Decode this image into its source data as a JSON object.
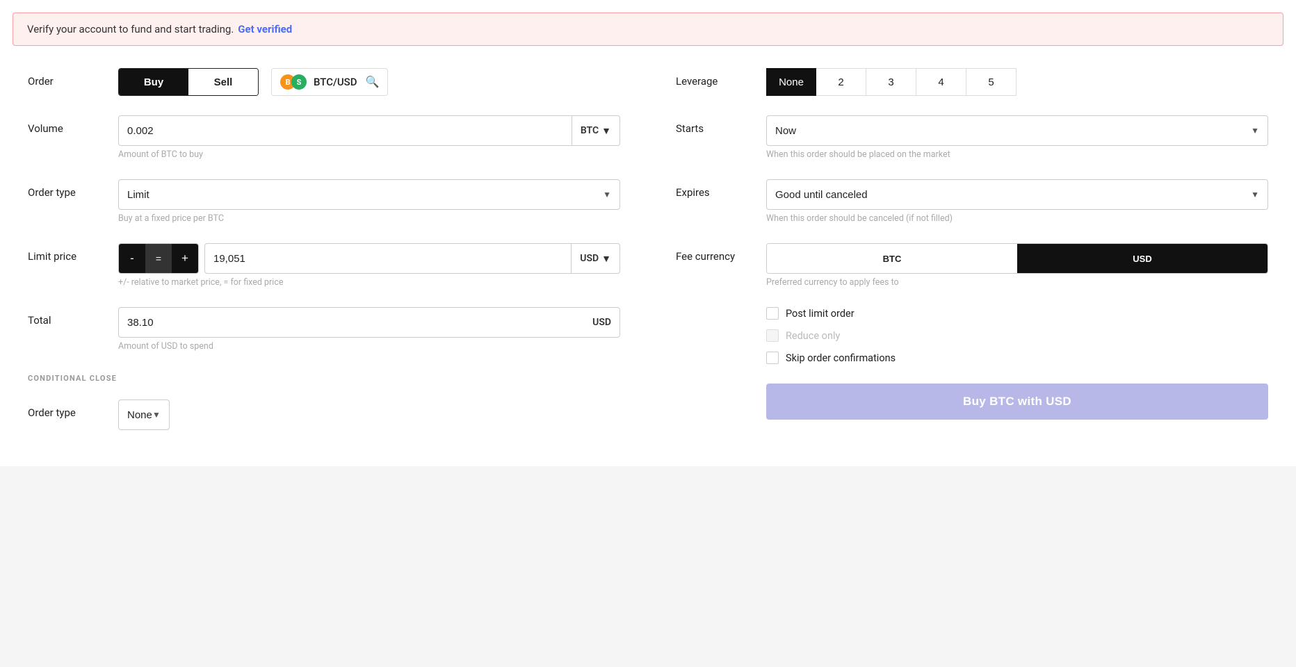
{
  "banner": {
    "text": "Verify your account to fund and start trading.",
    "link_text": "Get verified"
  },
  "order": {
    "label": "Order",
    "buy_label": "Buy",
    "sell_label": "Sell",
    "active": "Buy",
    "pair": "BTC/USD"
  },
  "leverage": {
    "label": "Leverage",
    "options": [
      "None",
      "2",
      "3",
      "4",
      "5"
    ],
    "active": "None"
  },
  "volume": {
    "label": "Volume",
    "value": "0.002",
    "currency": "BTC",
    "hint": "Amount of BTC to buy"
  },
  "starts": {
    "label": "Starts",
    "value": "Now",
    "hint": "When this order should be placed on the market"
  },
  "order_type": {
    "label": "Order type",
    "value": "Limit",
    "hint": "Buy at a fixed price per BTC"
  },
  "expires": {
    "label": "Expires",
    "value": "Good until canceled",
    "hint": "When this order should be canceled (if not filled)"
  },
  "limit_price": {
    "label": "Limit price",
    "minus": "-",
    "equal": "=",
    "plus": "+",
    "value": "19,051",
    "currency": "USD",
    "hint": "+/- relative to market price, = for fixed price"
  },
  "fee_currency": {
    "label": "Fee currency",
    "btc": "BTC",
    "usd": "USD",
    "active": "USD",
    "hint": "Preferred currency to apply fees to"
  },
  "total": {
    "label": "Total",
    "value": "38.10",
    "currency": "USD",
    "hint": "Amount of USD to spend"
  },
  "checkboxes": {
    "post_limit": {
      "label": "Post limit order",
      "checked": false,
      "disabled": false
    },
    "reduce_only": {
      "label": "Reduce only",
      "checked": false,
      "disabled": true
    },
    "skip_confirmations": {
      "label": "Skip order confirmations",
      "checked": false,
      "disabled": false
    }
  },
  "conditional_close": {
    "heading": "Conditional Close",
    "order_type_label": "Order type",
    "order_type_value": "None"
  },
  "buy_button": {
    "label": "Buy BTC with USD"
  }
}
